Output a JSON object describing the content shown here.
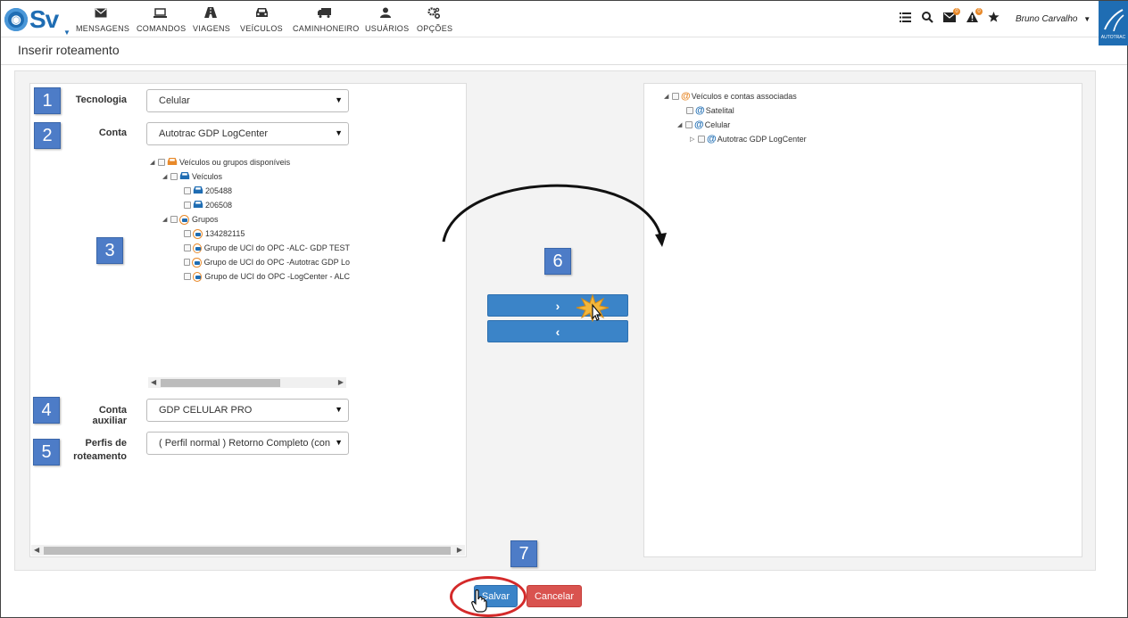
{
  "logo": {
    "text": "Sv"
  },
  "nav": [
    {
      "label": "MENSAGENS",
      "icon": "envelope-icon"
    },
    {
      "label": "COMANDOS",
      "icon": "laptop-icon"
    },
    {
      "label": "VIAGENS",
      "icon": "road-icon"
    },
    {
      "label": "VEÍCULOS",
      "icon": "car-icon"
    },
    {
      "label": "CAMINHONEIRO",
      "icon": "truck-icon"
    },
    {
      "label": "USUÁRIOS",
      "icon": "user-icon"
    },
    {
      "label": "OPÇÕES",
      "icon": "cogs-icon"
    }
  ],
  "header_right": {
    "user_name": "Bruno Carvalho",
    "messages_badge": "0",
    "alerts_badge": "0"
  },
  "brand": {
    "text": "AUTOTRAC"
  },
  "page": {
    "title": "Inserir roteamento"
  },
  "steps": [
    "1",
    "2",
    "3",
    "4",
    "5",
    "6",
    "7"
  ],
  "form": {
    "tecnologia": {
      "label": "Tecnologia",
      "value": "Celular"
    },
    "conta": {
      "label": "Conta",
      "value": "Autotrac GDP LogCenter"
    },
    "conta_auxiliar": {
      "label": "Conta auxiliar",
      "value": "GDP CELULAR PRO"
    },
    "perfis": {
      "label_line1": "Perfis de",
      "label_line2": "roteamento",
      "value": "( Perfil normal ) Retorno Completo (con"
    }
  },
  "left_tree": {
    "root": "Veículos ou grupos disponíveis",
    "vehicles_label": "Veículos",
    "vehicles": [
      "205488",
      "206508"
    ],
    "groups_label": "Grupos",
    "groups": [
      "134282115",
      "Grupo de UCI do OPC -ALC- GDP TEST",
      "Grupo de UCI do OPC -Autotrac GDP Lo",
      "Grupo de UCI do OPC -LogCenter - ALC"
    ]
  },
  "right_tree": {
    "root": "Veículos e contas associadas",
    "children": [
      {
        "label": "Satelital"
      },
      {
        "label": "Celular",
        "children": [
          {
            "label": "Autotrac GDP LogCenter"
          }
        ]
      }
    ]
  },
  "transfer": {
    "add_label": "›",
    "remove_label": "‹"
  },
  "actions": {
    "save_label": "Salvar",
    "cancel_label": "Cancelar"
  },
  "colors": {
    "primary": "#3b84c8",
    "danger": "#d9534f",
    "step": "#4d7cc7",
    "accent_orange": "#e8892a"
  }
}
